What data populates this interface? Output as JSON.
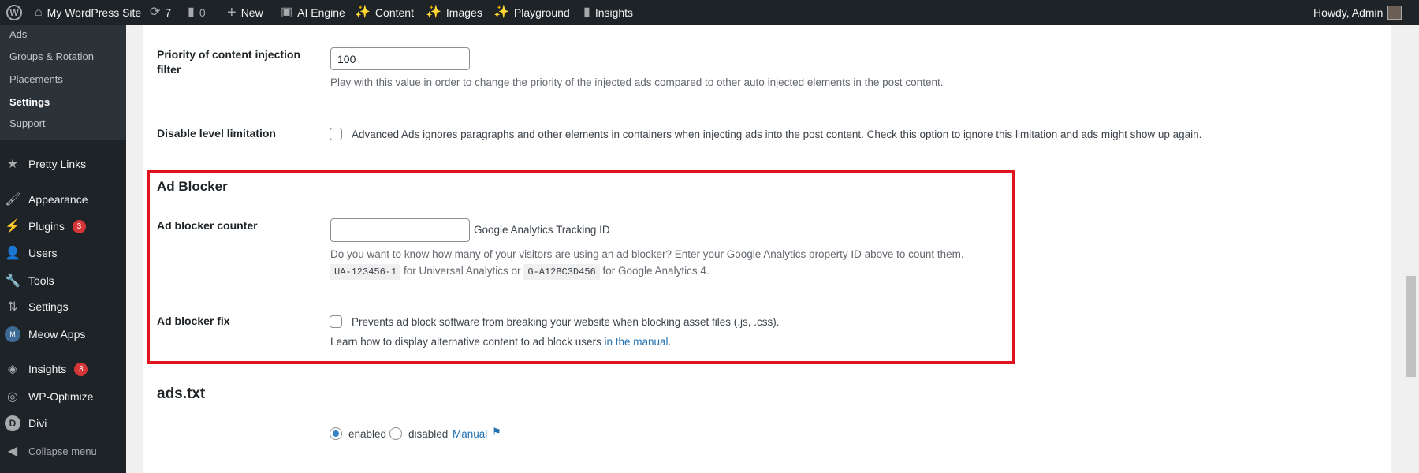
{
  "adminbar": {
    "site": "My WordPress Site",
    "updates": "7",
    "comments": "0",
    "new": "New",
    "ai_engine": "AI Engine",
    "content": "Content",
    "images": "Images",
    "playground": "Playground",
    "insights": "Insights",
    "howdy": "Howdy, Admin"
  },
  "submenu": [
    "Ads",
    "Groups & Rotation",
    "Placements",
    "Settings",
    "Support"
  ],
  "menu": {
    "pretty_links": "Pretty Links",
    "appearance": "Appearance",
    "plugins": "Plugins",
    "plugins_badge": "3",
    "users": "Users",
    "tools": "Tools",
    "settings": "Settings",
    "meow": "Meow Apps",
    "insights": "Insights",
    "insights_badge": "3",
    "wpo": "WP-Optimize",
    "divi": "Divi",
    "collapse": "Collapse menu"
  },
  "priority": {
    "label": "Priority of content injection filter",
    "value": "100",
    "desc": "Play with this value in order to change the priority of the injected ads compared to other auto injected elements in the post content."
  },
  "level": {
    "label": "Disable level limitation",
    "desc": "Advanced Ads ignores paragraphs and other elements in containers when injecting ads into the post content. Check this option to ignore this limitation and ads might show up again."
  },
  "adblocker": {
    "heading": "Ad Blocker",
    "counter_label": "Ad blocker counter",
    "counter_value": "",
    "counter_suffix": "Google Analytics Tracking ID",
    "counter_desc": "Do you want to know how many of your visitors are using an ad blocker? Enter your Google Analytics property ID above to count them.",
    "code1": "UA-123456-1",
    "mid": "for Universal Analytics or",
    "code2": "G-A12BC3D456",
    "end": "for Google Analytics 4.",
    "fix_label": "Ad blocker fix",
    "fix_desc": "Prevents ad block software from breaking your website when blocking asset files (.js, .css).",
    "learn": "Learn how to display alternative content to ad block users",
    "learn_link": "in the manual",
    "period": "."
  },
  "adstxt": {
    "heading": "ads.txt",
    "enabled": "enabled",
    "disabled": "disabled",
    "manual": "Manual"
  },
  "colors": {
    "highlight": "#e0141e",
    "accent": "#2271b1"
  }
}
